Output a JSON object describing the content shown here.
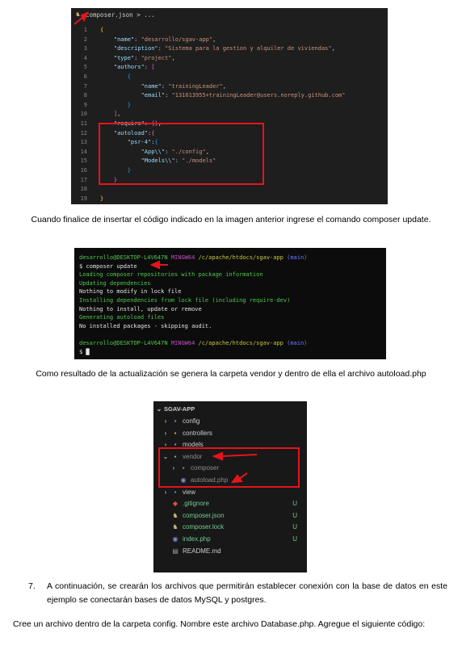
{
  "editor": {
    "tab_title": "composer.json > ...",
    "lines": [
      {
        "n": "1",
        "html": "<span class='b'>{</span>"
      },
      {
        "n": "2",
        "html": "    <span class='k'>\"name\"</span><span class='p'>: </span><span class='s'>\"desarrollo/sgav-app\"</span><span class='p'>,</span>"
      },
      {
        "n": "3",
        "html": "    <span class='k'>\"description\"</span><span class='p'>: </span><span class='s'>\"Sistema para la gestion y alquiler de viviendas\"</span><span class='p'>,</span>"
      },
      {
        "n": "4",
        "html": "    <span class='k'>\"type\"</span><span class='p'>: </span><span class='s'>\"project\"</span><span class='p'>,</span>"
      },
      {
        "n": "5",
        "html": "    <span class='k'>\"authors\"</span><span class='p'>: </span><span class='b2'>[</span>"
      },
      {
        "n": "6",
        "html": "        <span class='b3'>{</span>"
      },
      {
        "n": "7",
        "html": "            <span class='k'>\"name\"</span><span class='p'>: </span><span class='s'>\"trainingLeader\"</span><span class='p'>,</span>"
      },
      {
        "n": "8",
        "html": "            <span class='k'>\"email\"</span><span class='p'>: </span><span class='s'>\"131613955+trainingLeader@users.noreply.github.com\"</span>"
      },
      {
        "n": "9",
        "html": "        <span class='b3'>}</span>"
      },
      {
        "n": "10",
        "html": "    <span class='b2'>]</span><span class='p'>,</span>"
      },
      {
        "n": "11",
        "html": "    <span class='k'>\"require\"</span><span class='p'>: </span><span class='b2'>{}</span><span class='p'>,</span>"
      },
      {
        "n": "12",
        "html": "    <span class='k'>\"autoload\"</span><span class='p'>:</span><span class='b2'>{</span>"
      },
      {
        "n": "13",
        "html": "        <span class='k'>\"psr-4\"</span><span class='p'>:</span><span class='b3'>{</span>"
      },
      {
        "n": "14",
        "html": "            <span class='k'>\"App\\\\\"</span><span class='p'>: </span><span class='s'>\"./config\"</span><span class='p'>,</span>"
      },
      {
        "n": "15",
        "html": "            <span class='k'>\"Models\\\\\"</span><span class='p'>: </span><span class='s'>\"./models\"</span>"
      },
      {
        "n": "16",
        "html": "        <span class='b3'>}</span>"
      },
      {
        "n": "17",
        "html": "    <span class='b2'>}</span>"
      },
      {
        "n": "18",
        "html": ""
      },
      {
        "n": "19",
        "html": "<span class='b'>}</span>"
      }
    ]
  },
  "para1": "Cuando finalice de insertar el código indicado en la imagen anterior ingrese el comando composer update.",
  "terminal": {
    "lines": [
      {
        "html": "<span class='g'>desarrollo@DESKTOP-L4V647N</span> <span class='m'>MINGW64</span> <span class='y'>/c/apache/htdocs/sgav-app</span> <span class='bl'>(main)</span>"
      },
      {
        "html": "<span class='w'>$ composer update</span>"
      },
      {
        "html": "<span class='g'>Loading composer repositories with package information</span>"
      },
      {
        "html": "<span class='g'>Updating dependencies</span>"
      },
      {
        "html": "<span class='w'>Nothing to modify in lock file</span>"
      },
      {
        "html": "<span class='g'>Installing dependencies from lock file (including require-dev)</span>"
      },
      {
        "html": "<span class='w'>Nothing to install, update or remove</span>"
      },
      {
        "html": "<span class='g'>Generating autoload files</span>"
      },
      {
        "html": "<span class='w'>No installed packages - skipping audit.</span>"
      },
      {
        "html": ""
      },
      {
        "html": "<span class='g'>desarrollo@DESKTOP-L4V647N</span> <span class='m'>MINGW64</span> <span class='y'>/c/apache/htdocs/sgav-app</span> <span class='bl'>(main)</span>"
      },
      {
        "html": "<span class='w'>$ █</span>"
      }
    ]
  },
  "para2": "Como resultado de la actualización se genera la carpeta vendor y dentro de ella el archivo autoload.php",
  "explorer": {
    "root": "SGAV-APP",
    "items": [
      {
        "chev": "›",
        "icon": "folder-config-icon",
        "glyph": "▪",
        "color": "#6d8ddc",
        "label": "config",
        "indent": 0,
        "status": ""
      },
      {
        "chev": "›",
        "icon": "folder-controllers-icon",
        "glyph": "▪",
        "color": "#d9a441",
        "label": "controllers",
        "indent": 0,
        "status": ""
      },
      {
        "chev": "›",
        "icon": "folder-models-icon",
        "glyph": "▪",
        "color": "#c56bd6",
        "label": "models",
        "indent": 0,
        "status": ""
      },
      {
        "chev": "⌄",
        "icon": "folder-vendor-icon",
        "glyph": "▪",
        "color": "#c4a35a",
        "label": "vendor",
        "indent": 0,
        "status": "",
        "muted": true
      },
      {
        "chev": "›",
        "icon": "folder-composer-icon",
        "glyph": "▪",
        "color": "#8a8a8a",
        "label": "composer",
        "indent": 1,
        "status": "",
        "muted": true
      },
      {
        "chev": "",
        "icon": "php-file-icon",
        "glyph": "◉",
        "color": "#7f8ccf",
        "label": "autoload.php",
        "indent": 1,
        "status": "",
        "muted": true
      },
      {
        "chev": "›",
        "icon": "folder-view-icon",
        "glyph": "▪",
        "color": "#4a9ad6",
        "label": "view",
        "indent": 0,
        "status": ""
      },
      {
        "chev": "",
        "icon": "git-file-icon",
        "glyph": "◆",
        "color": "#e24f35",
        "label": ".gitignore",
        "indent": 0,
        "status": "U",
        "green": true
      },
      {
        "chev": "",
        "icon": "composer-file-icon",
        "glyph": "♞",
        "color": "#d7ba7d",
        "label": "composer.json",
        "indent": 0,
        "status": "U",
        "green": true
      },
      {
        "chev": "",
        "icon": "composer-file-icon",
        "glyph": "♞",
        "color": "#d7ba7d",
        "label": "composer.lock",
        "indent": 0,
        "status": "U",
        "green": true
      },
      {
        "chev": "",
        "icon": "php-file-icon",
        "glyph": "◉",
        "color": "#7f8ccf",
        "label": "index.php",
        "indent": 0,
        "status": "U",
        "green": true
      },
      {
        "chev": "",
        "icon": "markdown-file-icon",
        "glyph": "▤",
        "color": "#9a9a9a",
        "label": "README.md",
        "indent": 0,
        "status": ""
      }
    ]
  },
  "step7_number": "7.",
  "step7_text": "A continuación, se crearán los archivos que permitirán establecer conexión con la base de datos en este ejemplo se conectarán bases de datos MySQL y postgres.",
  "para3": "Cree un archivo dentro de la carpeta config. Nombre este archivo Database.php. Agregue el siguiente código:",
  "colors": {
    "highlight": "#e5141b",
    "editor_bg": "#1e1e1e",
    "terminal_bg": "#0c0c0c",
    "explorer_bg": "#181818"
  }
}
